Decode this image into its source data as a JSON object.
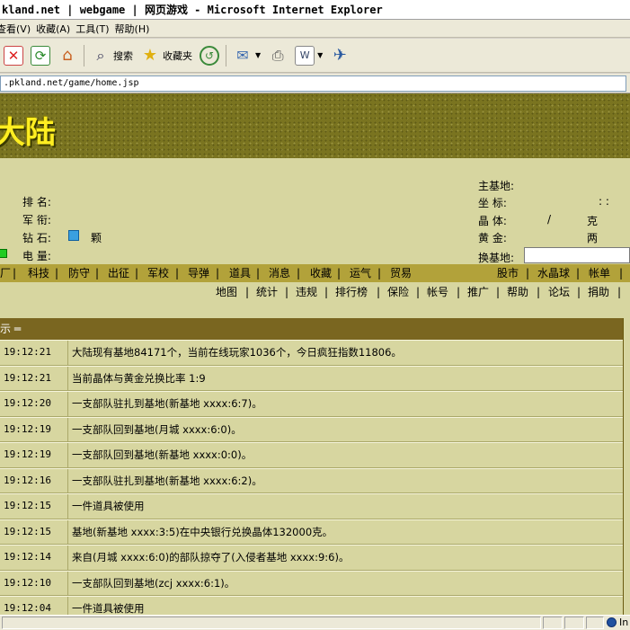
{
  "window": {
    "title": "kland.net | webgame | 网页游戏 - Microsoft Internet Explorer"
  },
  "menu": [
    "查看(V)",
    "收藏(A)",
    "工具(T)",
    "帮助(H)"
  ],
  "toolbar": {
    "search_label": "搜索",
    "favorites_label": "收藏夹",
    "icons": [
      "close-icon",
      "refresh-icon",
      "home-icon",
      "search-icon",
      "favorites-icon",
      "history-icon",
      "mail-icon",
      "print-icon",
      "edit-icon",
      "messenger-icon"
    ]
  },
  "address": {
    "url": ".pkland.net/game/home.jsp"
  },
  "banner": {
    "logo_text": "大陆"
  },
  "info_left": {
    "rank_label": "排  名:",
    "military_label": "军  衔:",
    "diamond_label": "钻  石:",
    "diamond_unit": "颗",
    "power_label": "电  量:"
  },
  "info_right": {
    "main_base_label": "主基地:",
    "coords_label": "坐  标:",
    "coords_value": ": :",
    "crystal_label": "晶  体:",
    "crystal_sep": "/",
    "crystal_unit": "克",
    "gold_label": "黄  金:",
    "gold_unit": "两",
    "switch_base_label": "换基地:"
  },
  "nav_primary": [
    "厂",
    "科技",
    "防守",
    "出征",
    "军校",
    "导弹",
    "道具",
    "消息",
    "收藏",
    "运气",
    "贸易"
  ],
  "nav_primary_right": [
    "股市",
    "水晶球",
    "帐单"
  ],
  "nav_secondary": [
    "地图",
    "统计",
    "违规",
    "排行榜",
    "保险",
    "帐号",
    "推广",
    "帮助",
    "论坛",
    "捐助"
  ],
  "messages": {
    "header": "示 ═",
    "rows": [
      {
        "time": "19:12:21",
        "text": "大陆现有基地84171个，当前在线玩家1036个，今日疯狂指数11806。"
      },
      {
        "time": "19:12:21",
        "text": "当前晶体与黄金兑换比率 1:9"
      },
      {
        "time": "19:12:20",
        "text": "一支部队驻扎到基地(新基地 xxxx:6:7)。"
      },
      {
        "time": "19:12:19",
        "text": "一支部队回到基地(月城 xxxx:6:0)。"
      },
      {
        "time": "19:12:19",
        "text": "一支部队回到基地(新基地 xxxx:0:0)。"
      },
      {
        "time": "19:12:16",
        "text": "一支部队驻扎到基地(新基地 xxxx:6:2)。"
      },
      {
        "time": "19:12:15",
        "text": "一件道具被使用"
      },
      {
        "time": "19:12:15",
        "text": "基地(新基地 xxxx:3:5)在中央银行兑换晶体132000克。"
      },
      {
        "time": "19:12:14",
        "text": "来自(月城 xxxx:6:0)的部队掠夺了(入侵者基地 xxxx:9:6)。"
      },
      {
        "time": "19:12:10",
        "text": "一支部队回到基地(zcj xxxx:6:1)。"
      },
      {
        "time": "19:12:04",
        "text": "一件道具被使用"
      }
    ]
  },
  "status": {
    "zone": "In"
  },
  "colors": {
    "nav_bg": "#b2a23a",
    "page_bg": "#d7d6a0",
    "header_bg": "#7a6620",
    "banner": "#7a7420",
    "logo": "#ffee22"
  }
}
